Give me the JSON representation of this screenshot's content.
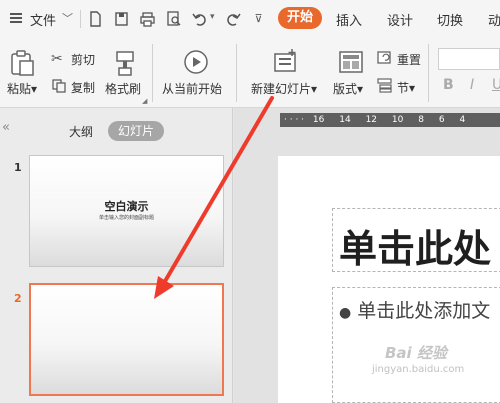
{
  "menu": {
    "file": "文件"
  },
  "tabs": [
    "开始",
    "插入",
    "设计",
    "切换",
    "动"
  ],
  "ribbon": {
    "paste": "粘贴",
    "cut": "剪切",
    "copy": "复制",
    "format_painter": "格式刷",
    "play_from_current": "从当前开始",
    "new_slide": "新建幻灯片",
    "layout": "版式",
    "reset": "重置",
    "section": "节"
  },
  "left_panel": {
    "view_tabs": [
      "大纲",
      "幻灯片"
    ],
    "slides": [
      {
        "number": "1",
        "title": "空白演示",
        "subtitle": "单击输入您的封面副标题"
      },
      {
        "number": "2"
      }
    ]
  },
  "ruler": {
    "ticks": [
      "16",
      "14",
      "12",
      "10",
      "8",
      "6",
      "4"
    ]
  },
  "slide": {
    "title_placeholder": "单击此处",
    "body_placeholder": "单击此处添加文"
  },
  "watermark": {
    "line1": "Bai 经验",
    "line2": "jingyan.baidu.com"
  },
  "colors": {
    "accent": "#e9692c",
    "selection": "#f07850",
    "arrow": "#ee3b2b"
  }
}
